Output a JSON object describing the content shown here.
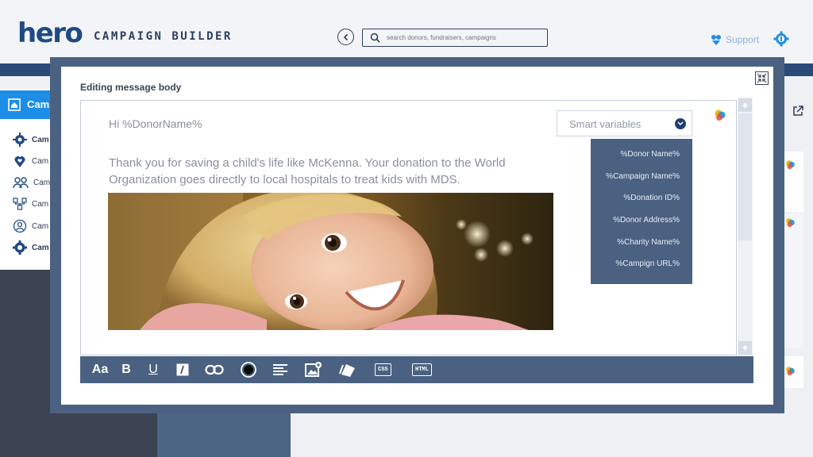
{
  "header": {
    "logo": "hero",
    "app_title": "CAMPAIGN BUILDER",
    "search_placeholder": "search donors, fundraisers, campaigns",
    "support_label": "Support"
  },
  "sidebar": {
    "active_label": "Cam",
    "items": [
      {
        "label": "Cam",
        "icon": "gear-hub-icon"
      },
      {
        "label": "Cam",
        "icon": "heart-pin-icon"
      },
      {
        "label": "Cam",
        "icon": "users-icon"
      },
      {
        "label": "Cam",
        "icon": "network-icon"
      },
      {
        "label": "Cam",
        "icon": "user-circle-icon"
      },
      {
        "label": "Cam",
        "icon": "settings-gear-icon"
      }
    ]
  },
  "modal": {
    "title": "Editing message body",
    "greeting": "Hi %DonorName%",
    "body": "Thank you for saving a child's life like McKenna. Your donation to the World Organization goes directly to local hospitals to treat kids with MDS.",
    "smart_variables": {
      "label": "Smart variables",
      "items": [
        "%Donor Name%",
        "%Campaign Name%",
        "%Donation ID%",
        "%Donor Address%",
        "%Charity Name%",
        "%Campign URL%"
      ]
    },
    "toolbar": {
      "font": "Aa",
      "bold": "B",
      "underline": "U",
      "css": "CSS",
      "html": "HTML"
    }
  },
  "colors": {
    "brand": "#1f4a84",
    "accent_blue": "#1d8ee7",
    "modal_frame": "#4b6181",
    "support": "#8fb4da"
  }
}
